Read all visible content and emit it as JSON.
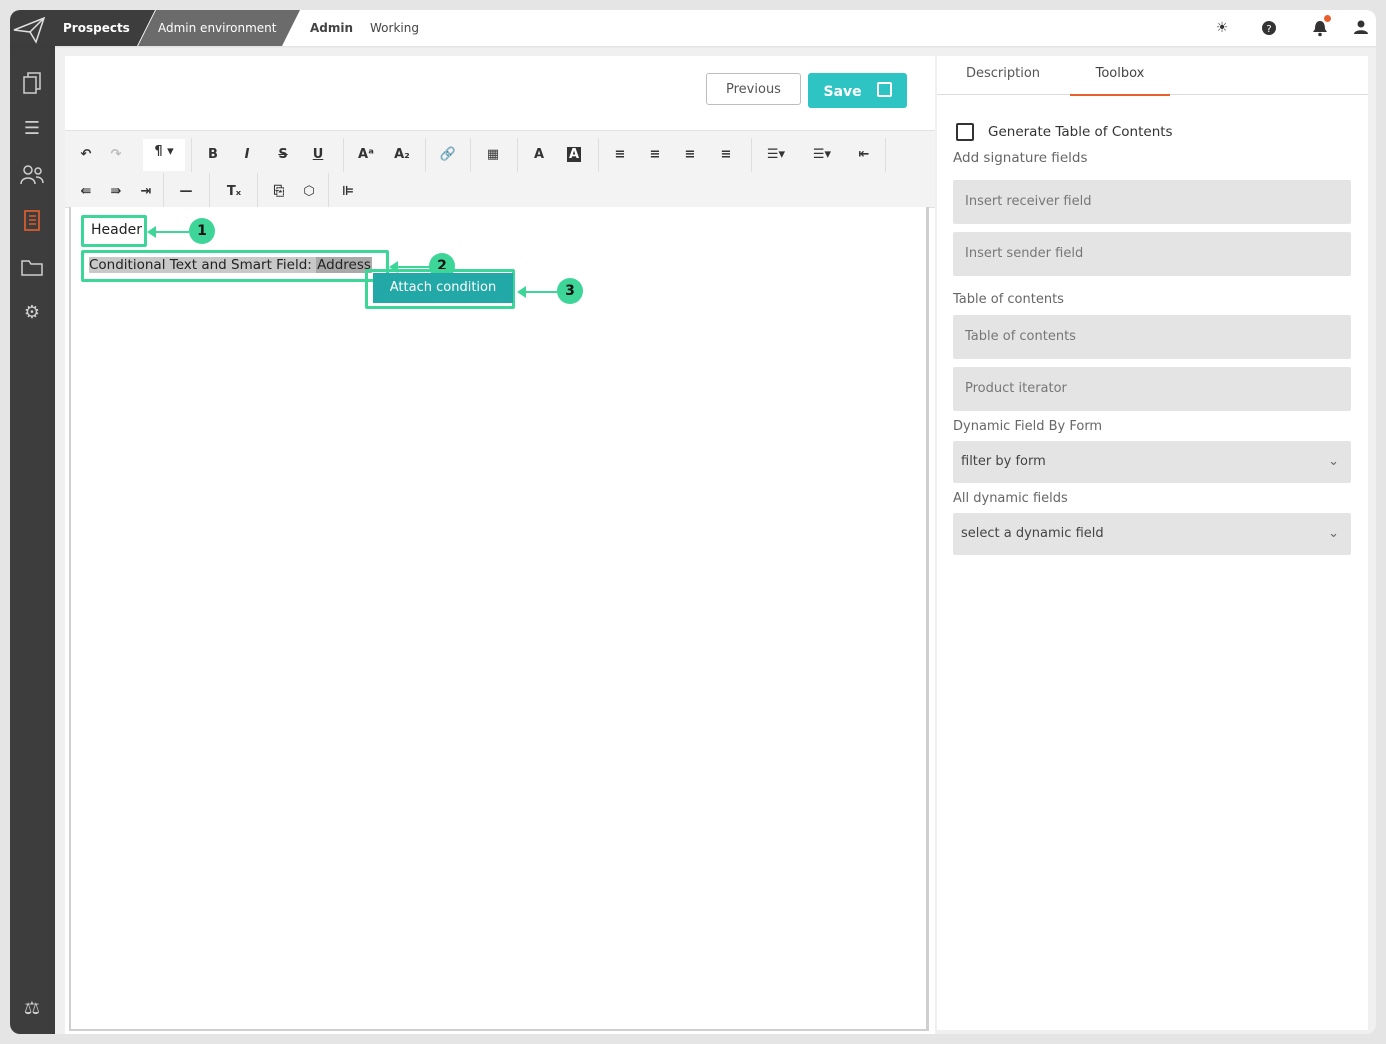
{
  "topbar": {
    "breadcrumbs": [
      "Prospects",
      "Admin environment"
    ],
    "nav": [
      "Admin",
      "Working"
    ],
    "icons": [
      "sun-icon",
      "help-icon",
      "bell-icon",
      "user-icon"
    ],
    "notification_dot_color": "#e8602c"
  },
  "editor": {
    "previous_label": "Previous",
    "save_label": "Save",
    "header_text": "Header",
    "smart_text_prefix": "Conditional Text and Smart Field: ",
    "smart_field": "Address",
    "attach_condition_label": "Attach condition",
    "callouts": [
      "1",
      "2",
      "3"
    ]
  },
  "rightpanel": {
    "tabs": [
      "Description",
      "Toolbox"
    ],
    "active_tab": "Toolbox",
    "generate_toc_label": "Generate Table of Contents",
    "signature_section": "Add signature fields",
    "insert_receiver": "Insert receiver field",
    "insert_sender": "Insert sender field",
    "toc_section": "Table of contents",
    "toc_button": "Table of contents",
    "product_iterator": "Product iterator",
    "dynamic_by_form_section": "Dynamic Field By Form",
    "filter_by_form": "filter by form",
    "all_dynamic_section": "All dynamic fields",
    "select_dynamic": "select a dynamic field"
  },
  "colors": {
    "accent": "#2ec4c4",
    "highlight": "#3ed598",
    "tab_underline": "#e8602c",
    "rail": "#3d3d3d"
  }
}
